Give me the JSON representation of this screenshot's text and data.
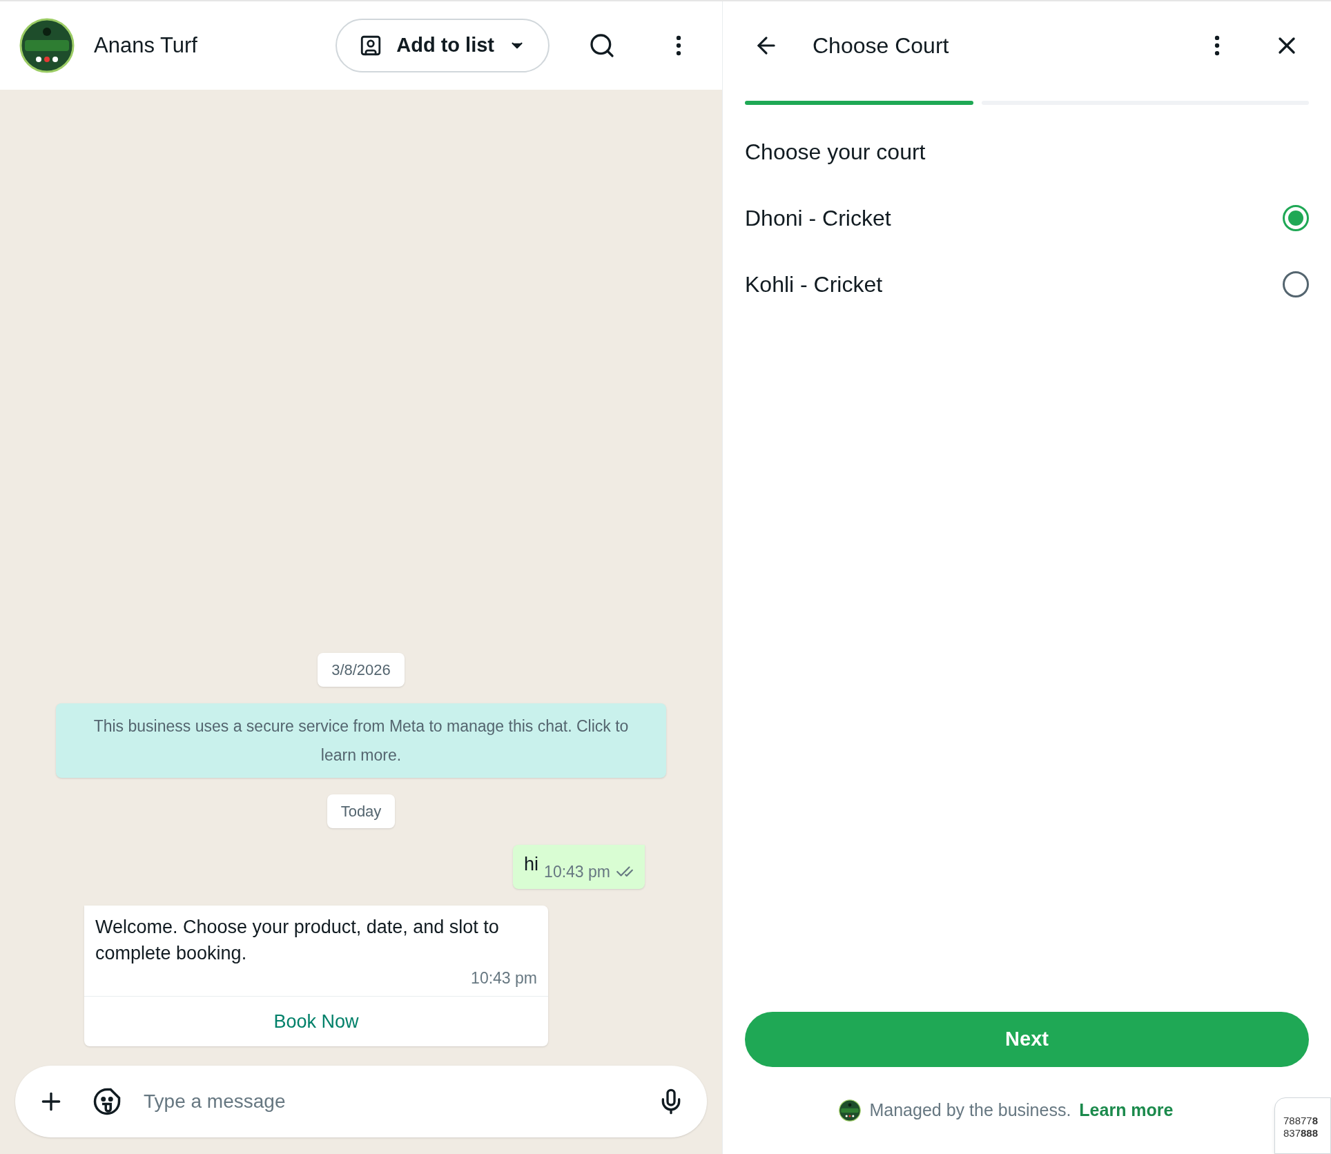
{
  "chat": {
    "name": "Anans Turf",
    "add_to_list": "Add to list"
  },
  "messages": [
    {
      "kind": "date",
      "text": "3/8/2026"
    },
    {
      "kind": "system",
      "text": "This business uses a secure service from Meta to manage this chat. Click to learn more."
    },
    {
      "kind": "date",
      "text": "Today"
    },
    {
      "kind": "outgoing",
      "text": "hi",
      "time": "10:43 pm"
    },
    {
      "kind": "incoming",
      "text": "Welcome. Choose your product, date, and slot to complete booking.",
      "time": "10:43 pm",
      "action": "Book Now"
    }
  ],
  "composer": {
    "placeholder": "Type a message"
  },
  "flow": {
    "title": "Choose Court",
    "steps": [
      {
        "done": true
      },
      {
        "done": false
      }
    ],
    "heading": "Choose your court",
    "options": [
      {
        "label": "Dhoni - Cricket",
        "selected": true
      },
      {
        "label": "Kohli - Cricket",
        "selected": false
      }
    ],
    "next": "Next",
    "managed": "Managed by the business.",
    "learn_more": "Learn more"
  },
  "corner_card": [
    "78877**8**",
    "837**888**"
  ]
}
